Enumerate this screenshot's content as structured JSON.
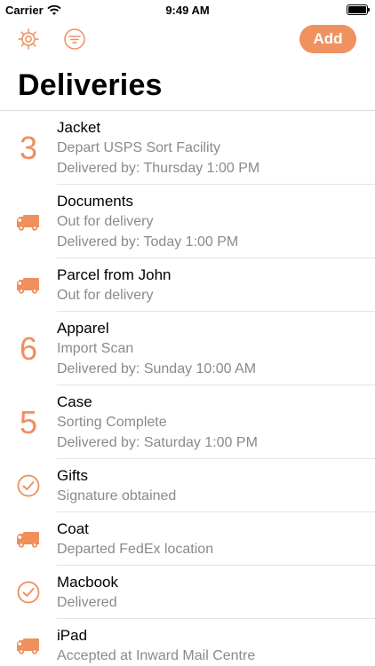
{
  "status_bar": {
    "carrier": "Carrier",
    "time": "9:49 AM"
  },
  "toolbar": {
    "settings_icon": "gear-icon",
    "filter_icon": "filter-icon",
    "add_label": "Add"
  },
  "title": "Deliveries",
  "colors": {
    "accent": "#f09160",
    "accent_text": "#ef8f5d",
    "subtitle": "#8a8a8a"
  },
  "deliveries": [
    {
      "lead_type": "number",
      "lead": "3",
      "title": "Jacket",
      "status": "Depart USPS Sort Facility",
      "eta": "Delivered by: Thursday 1:00 PM"
    },
    {
      "lead_type": "icon",
      "lead": "truck-icon",
      "title": "Documents",
      "status": "Out for delivery",
      "eta": "Delivered by: Today 1:00 PM"
    },
    {
      "lead_type": "icon",
      "lead": "truck-icon",
      "title": "Parcel from John",
      "status": "Out for delivery",
      "eta": ""
    },
    {
      "lead_type": "number",
      "lead": "6",
      "title": "Apparel",
      "status": "Import Scan",
      "eta": "Delivered by: Sunday 10:00 AM"
    },
    {
      "lead_type": "number",
      "lead": "5",
      "title": "Case",
      "status": "Sorting Complete",
      "eta": "Delivered by: Saturday 1:00 PM"
    },
    {
      "lead_type": "icon",
      "lead": "check-circle-icon",
      "title": "Gifts",
      "status": "Signature obtained",
      "eta": ""
    },
    {
      "lead_type": "icon",
      "lead": "truck-icon",
      "title": "Coat",
      "status": "Departed FedEx location",
      "eta": ""
    },
    {
      "lead_type": "icon",
      "lead": "check-circle-icon",
      "title": "Macbook",
      "status": "Delivered",
      "eta": ""
    },
    {
      "lead_type": "icon",
      "lead": "truck-icon",
      "title": "iPad",
      "status": "Accepted at Inward Mail Centre",
      "eta": ""
    }
  ]
}
